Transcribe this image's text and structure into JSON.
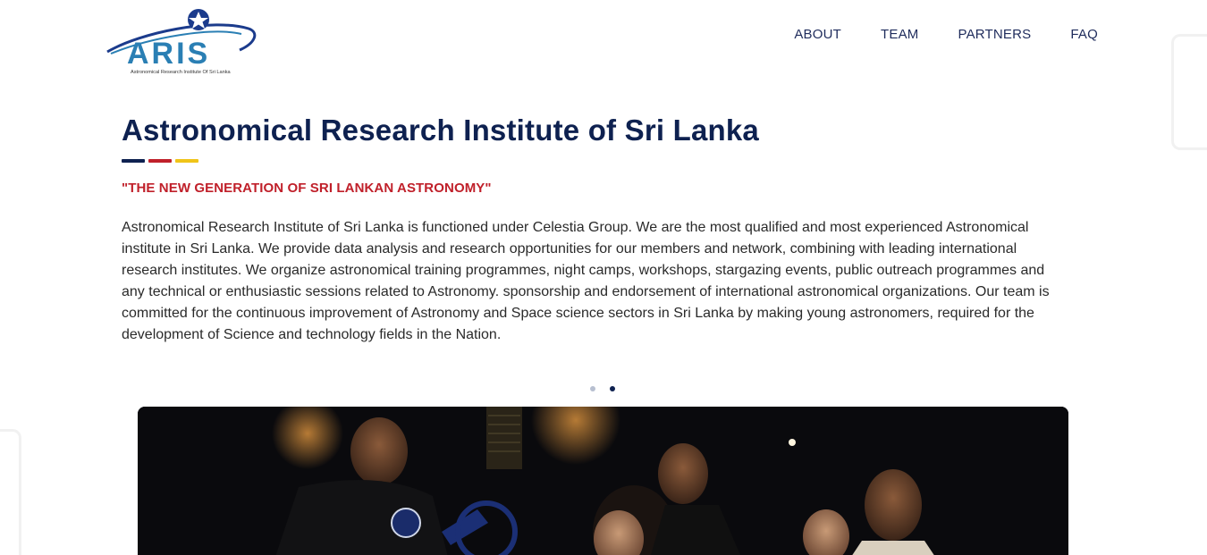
{
  "header": {
    "logo_text": "ARIS",
    "logo_subtext": "Astronomical Research Institute Of Sri Lanka",
    "nav": [
      "ABOUT",
      "TEAM",
      "PARTNERS",
      "FAQ"
    ]
  },
  "hero": {
    "title": "Astronomical Research Institute of Sri Lanka",
    "tagline": "\"THE NEW GENERATION OF SRI LANKAN ASTRONOMY\"",
    "description": "Astronomical Research Institute of Sri Lanka is functioned under Celestia Group. We are the most qualified and most experienced Astronomical institute in Sri Lanka. We provide data analysis and research opportunities for our members and network, combining with leading international research institutes. We organize astronomical training programmes, night camps, workshops, stargazing events, public outreach programmes and any technical or enthusiastic sessions related to Astronomy. sponsorship and endorsement of international astronomical organizations. Our team is committed for the continuous improvement of Astronomy and Space science sectors in Sri Lanka by making young astronomers, required for the development of Science and technology fields in the Nation.",
    "accent_bars": [
      "#0e2150",
      "#c0202a",
      "#f0c419"
    ]
  },
  "carousel": {
    "dot_count": 2,
    "active_index": 1,
    "dot_inactive_color": "#b7bfd0",
    "dot_active_color": "#0e2150"
  },
  "colors": {
    "navy": "#0e2150",
    "red": "#c0202a",
    "yellow": "#f0c419",
    "logo_blue": "#2a7fb4"
  }
}
